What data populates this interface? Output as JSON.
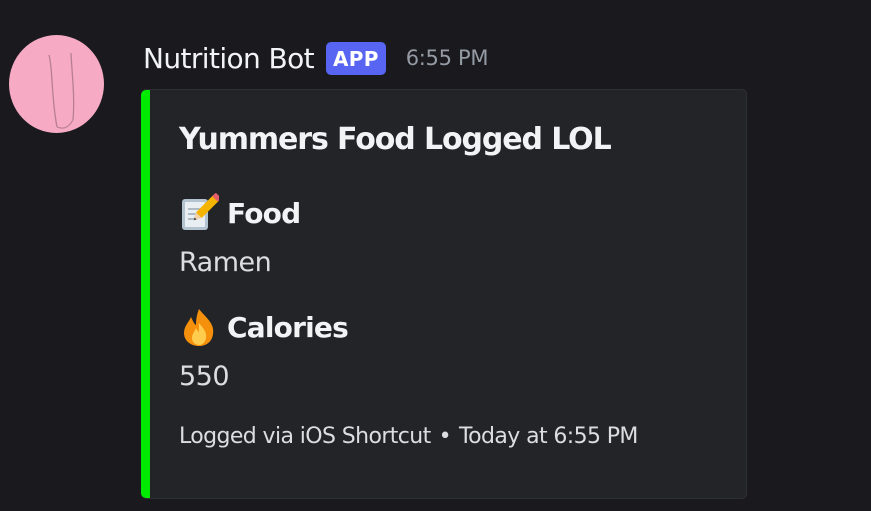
{
  "message": {
    "username": "Nutrition Bot",
    "badge": "APP",
    "timestamp": "6:55 PM"
  },
  "embed": {
    "accent_color": "#00ea00",
    "title": "Yummers Food Logged LOL",
    "fields": [
      {
        "icon": "memo-pencil-icon",
        "name": "Food",
        "value": "Ramen"
      },
      {
        "icon": "fire-icon",
        "name": "Calories",
        "value": "550"
      }
    ],
    "footer": {
      "text": "Logged via iOS Shortcut",
      "separator": "•",
      "timestamp": "Today at 6:55 PM"
    }
  },
  "colors": {
    "background": "#1a1a1e",
    "embed_background": "#232428",
    "badge": "#5865f2",
    "avatar": "#f6aac3"
  }
}
